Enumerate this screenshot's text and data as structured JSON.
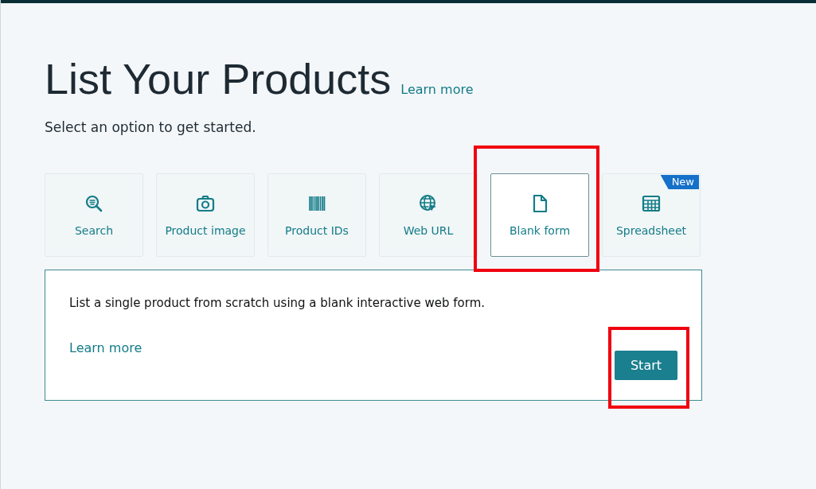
{
  "title": "List Your Products",
  "title_link": "Learn more",
  "subtitle": "Select an option to get started.",
  "options": [
    {
      "label": "Search",
      "kind": "search",
      "selected": false,
      "highlighted": false
    },
    {
      "label": "Product image",
      "kind": "camera",
      "selected": false,
      "highlighted": false
    },
    {
      "label": "Product IDs",
      "kind": "barcode",
      "selected": false,
      "highlighted": false
    },
    {
      "label": "Web URL",
      "kind": "globe",
      "selected": false,
      "highlighted": false
    },
    {
      "label": "Blank form",
      "kind": "document",
      "selected": true,
      "highlighted": true
    },
    {
      "label": "Spreadsheet",
      "kind": "grid",
      "selected": false,
      "highlighted": false,
      "badge": "New"
    }
  ],
  "panel": {
    "description": "List a single product from scratch using a blank interactive web form.",
    "link": "Learn more",
    "button": {
      "label": "Start",
      "highlighted": true
    }
  }
}
